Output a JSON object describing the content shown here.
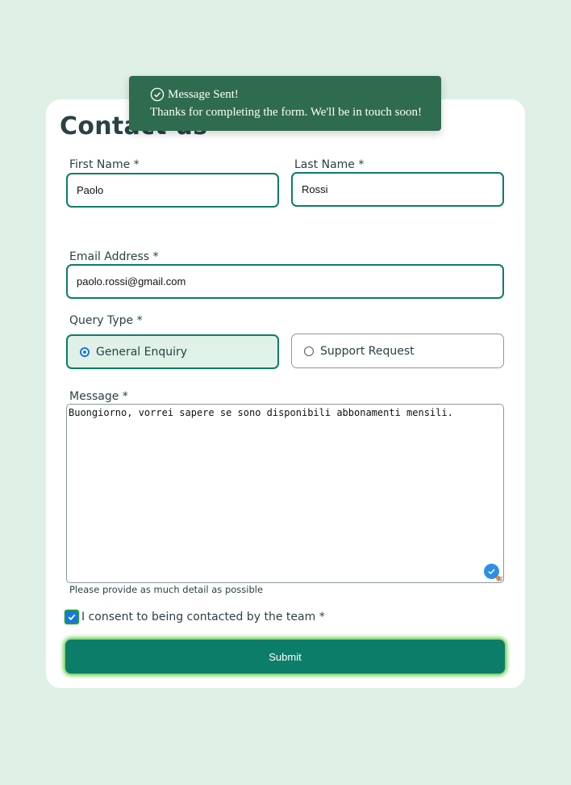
{
  "toast": {
    "heading": "Message Sent!",
    "body": "Thanks for completing the form. We'll be in touch soon!",
    "icon": "check-circle-icon"
  },
  "form": {
    "title": "Contact us",
    "first_name": {
      "label": "First Name *",
      "value": "Paolo"
    },
    "last_name": {
      "label": "Last Name *",
      "value": "Rossi"
    },
    "email": {
      "label": "Email Address *",
      "value": "paolo.rossi@gmail.com"
    },
    "query_type": {
      "label": "Query Type *",
      "options": [
        "General Enquiry",
        "Support Request"
      ],
      "selected": "General Enquiry"
    },
    "message": {
      "label": "Message *",
      "value": "Buongiorno, vorrei sapere se sono disponibili abbonamenti mensili.",
      "hint": "Please provide as much detail as possible"
    },
    "consent": {
      "label": "I consent to being contacted by the team *",
      "checked": true
    },
    "submit_label": "Submit"
  },
  "colors": {
    "page_background": "#dff0e6",
    "accent": "#0c7d69",
    "toast_background": "#2f6b4f",
    "selected_option_background": "#e0f1e8"
  }
}
